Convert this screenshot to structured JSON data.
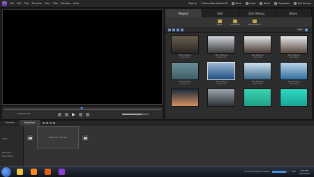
{
  "menubar": {
    "items": [
      "File",
      "Edit",
      "Clip",
      "Timeline",
      "Disc",
      "Title",
      "Window",
      "Help"
    ],
    "signin": "Sign In",
    "create_id": "Create New Adobe ID",
    "save": "Save",
    "undo": "Undo",
    "redo": "Redo",
    "organizer": "Organizer",
    "fullscreen": "Full Screen"
  },
  "monitor": {
    "timecode": "00;00;00;00"
  },
  "panel": {
    "tabs": [
      "Project",
      "Edit",
      "Disc Menus",
      "Share"
    ],
    "active_tab": "Project",
    "subtools": [
      "Media",
      "Get Media",
      "Instant Movie"
    ],
    "view_label": "View"
  },
  "thumbnails": [
    {
      "label": "SNC_0001.jpg",
      "sub": "00;00;05;00",
      "colors": [
        "#6a5e50",
        "#2a2622"
      ],
      "selected": false
    },
    {
      "label": "SNC_0003.jpg",
      "sub": "00;00;05;00",
      "colors": [
        "#cfd4da",
        "#3a3a3a"
      ],
      "selected": false
    },
    {
      "label": "SNC_0004.jpg",
      "sub": "00;00;05;00",
      "colors": [
        "#dfe3e6",
        "#4a3a33"
      ],
      "selected": false
    },
    {
      "label": "SNC_0005.jpg",
      "sub": "00;00;05;00",
      "colors": [
        "#e6e8ea",
        "#5a4a40"
      ],
      "selected": false
    },
    {
      "label": "SNC_0007.jpg",
      "sub": "00;00;05;00",
      "colors": [
        "#6b8f96",
        "#3e5d66"
      ],
      "selected": false
    },
    {
      "label": "SNC_0008.jpg",
      "sub": "00;00;05;00",
      "colors": [
        "#9db8d8",
        "#1f4f80"
      ],
      "selected": true
    },
    {
      "label": "SNC_0009.jpg",
      "sub": "00;00;05;00",
      "colors": [
        "#cfe0ef",
        "#3a6a8a"
      ],
      "selected": false
    },
    {
      "label": "SNC_0010.jpg",
      "sub": "00;00;05;00",
      "colors": [
        "#b9d2ea",
        "#2f6f9f"
      ],
      "selected": false
    },
    {
      "label": "",
      "sub": "",
      "colors": [
        "#1d2b3c",
        "#d09060"
      ],
      "selected": false
    },
    {
      "label": "",
      "sub": "",
      "colors": [
        "#9aa4ad",
        "#2e3338"
      ],
      "selected": false
    },
    {
      "label": "",
      "sub": "",
      "colors": [
        "#3ad3b0",
        "#1fa08a"
      ],
      "selected": false
    },
    {
      "label": "",
      "sub": "",
      "colors": [
        "#2fd8c2",
        "#1aa69a"
      ],
      "selected": false
    }
  ],
  "timeline": {
    "tabs": [
      "Timeline",
      "Sceneline"
    ],
    "active_tab": "Sceneline",
    "tracks": [
      "Video",
      "Narration",
      "Soundtrack"
    ],
    "drop_text": "Drag next clip here"
  },
  "taskbar": {
    "render_status": "Conforming SNC_0172.MOV",
    "render_percent": "80%",
    "time": "9:25 PM",
    "date": "12/27/2010",
    "apps": [
      {
        "icon": "explorer-icon",
        "color": "#f0c040"
      },
      {
        "icon": "media-player-icon",
        "color": "#ff8a1e"
      },
      {
        "icon": "firefox-icon",
        "color": "#e0601a"
      },
      {
        "icon": "premiere-elements-icon",
        "color": "#8b3fd6"
      }
    ]
  }
}
